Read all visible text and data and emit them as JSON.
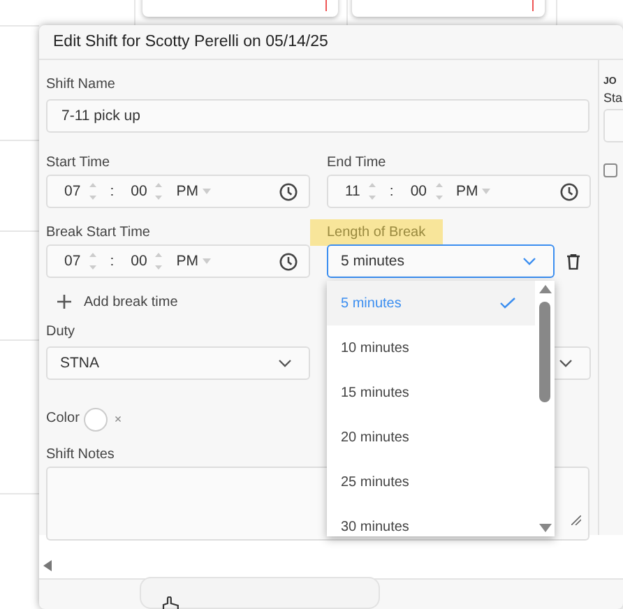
{
  "dialog": {
    "title": "Edit Shift for Scotty Perelli on 05/14/25",
    "shift_name": {
      "label": "Shift Name",
      "value": "7-11 pick up"
    },
    "start_time": {
      "label": "Start Time",
      "hour": "07",
      "separator": ":",
      "minute": "00",
      "period": "PM"
    },
    "end_time": {
      "label": "End Time",
      "hour": "11",
      "separator": ":",
      "minute": "00",
      "period": "PM"
    },
    "break_start_time": {
      "label": "Break Start Time",
      "hour": "07",
      "separator": ":",
      "minute": "00",
      "period": "PM"
    },
    "length_of_break": {
      "label": "Length of Break",
      "highlighted": true,
      "value": "5 minutes",
      "open": true,
      "options": [
        {
          "label": "5 minutes",
          "selected": true
        },
        {
          "label": "10 minutes",
          "selected": false
        },
        {
          "label": "15 minutes",
          "selected": false
        },
        {
          "label": "20 minutes",
          "selected": false
        },
        {
          "label": "25 minutes",
          "selected": false
        },
        {
          "label": "30 minutes",
          "selected": false
        }
      ]
    },
    "add_break": {
      "label": "Add break time"
    },
    "duty": {
      "label": "Duty",
      "value": "STNA"
    },
    "color": {
      "label": "Color",
      "clear": "×"
    },
    "shift_notes": {
      "label": "Shift Notes"
    },
    "side_panel": {
      "heading": "JO",
      "label": "Sta",
      "checked": false
    }
  }
}
